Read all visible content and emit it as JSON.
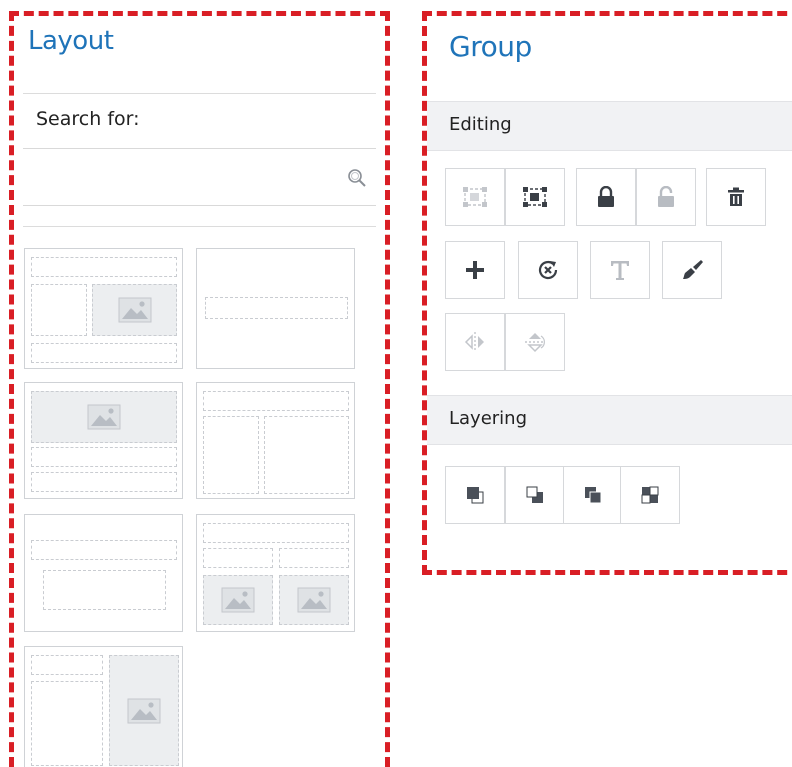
{
  "layout_panel": {
    "title": "Layout",
    "search_label": "Search for:",
    "search_value": "",
    "search_placeholder": "",
    "templates": [
      "two-column-with-image",
      "single-text-block",
      "image-header-with-rows",
      "header-two-columns",
      "two-text-blocks",
      "header-two-images",
      "sidebar-with-image"
    ]
  },
  "group_panel": {
    "title": "Group",
    "editing": {
      "label": "Editing",
      "tools": [
        {
          "icon": "group-icon",
          "enabled": false
        },
        {
          "icon": "ungroup-icon",
          "enabled": true
        },
        {
          "icon": "lock-icon",
          "enabled": true
        },
        {
          "icon": "unlock-icon",
          "enabled": false
        },
        {
          "icon": "trash-icon",
          "enabled": true
        },
        {
          "icon": "plus-icon",
          "enabled": true
        },
        {
          "icon": "rotate-reset-icon",
          "enabled": true
        },
        {
          "icon": "text-icon",
          "enabled": false
        },
        {
          "icon": "brush-icon",
          "enabled": true
        },
        {
          "icon": "flip-horizontal-icon",
          "enabled": false
        },
        {
          "icon": "flip-vertical-icon",
          "enabled": false
        }
      ]
    },
    "layering": {
      "label": "Layering",
      "tools": [
        {
          "icon": "bring-to-front-icon",
          "enabled": true
        },
        {
          "icon": "send-to-back-icon",
          "enabled": true
        },
        {
          "icon": "bring-forward-icon",
          "enabled": true
        },
        {
          "icon": "send-backward-icon",
          "enabled": true
        }
      ]
    }
  },
  "colors": {
    "title_blue": "#1f74b9",
    "frame_red": "#d91e25",
    "icon_dark": "#3a3f46",
    "icon_disabled": "#b8bcc2"
  }
}
